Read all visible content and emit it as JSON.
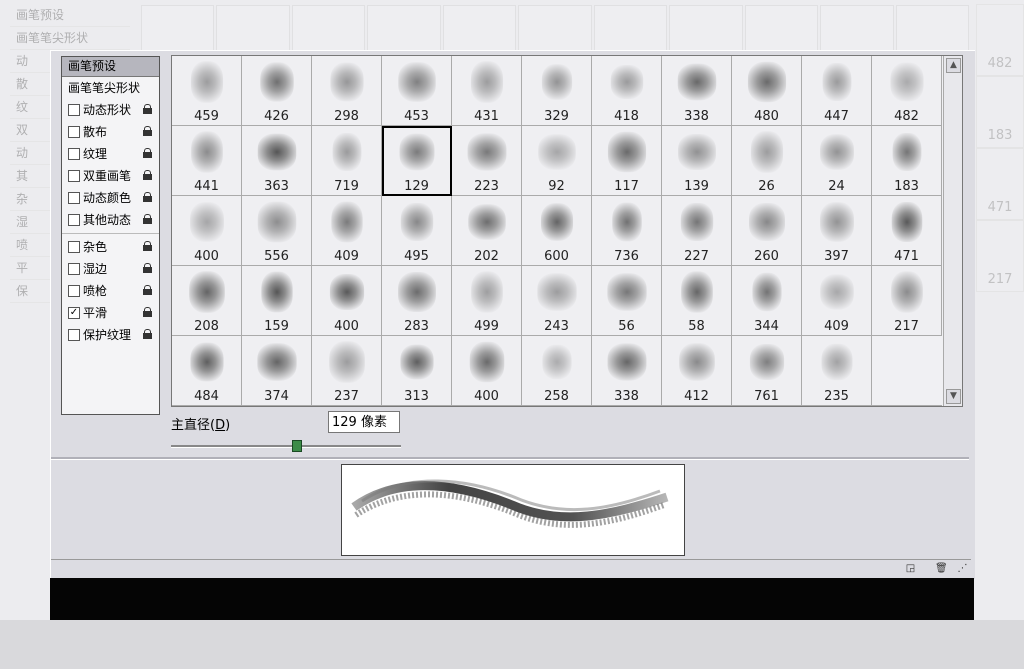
{
  "panel": {
    "preset_tab": "画笔预设",
    "tip_shape": "画笔笔尖形状",
    "options": [
      {
        "label": "动态形状",
        "checked": false
      },
      {
        "label": "散布",
        "checked": false
      },
      {
        "label": "纹理",
        "checked": false
      },
      {
        "label": "双重画笔",
        "checked": false
      },
      {
        "label": "动态颜色",
        "checked": false
      },
      {
        "label": "其他动态",
        "checked": false
      },
      {
        "label": "杂色",
        "checked": false
      },
      {
        "label": "湿边",
        "checked": false
      },
      {
        "label": "喷枪",
        "checked": false
      },
      {
        "label": "平滑",
        "checked": true
      },
      {
        "label": "保护纹理",
        "checked": false
      }
    ]
  },
  "brushes": [
    "459",
    "426",
    "298",
    "453",
    "431",
    "329",
    "418",
    "338",
    "480",
    "447",
    "482",
    "441",
    "363",
    "719",
    "129",
    "223",
    "92",
    "117",
    "139",
    "26",
    "24",
    "183",
    "400",
    "556",
    "409",
    "495",
    "202",
    "600",
    "736",
    "227",
    "260",
    "397",
    "471",
    "208",
    "159",
    "400",
    "283",
    "499",
    "243",
    "56",
    "58",
    "344",
    "409",
    "217",
    "484",
    "374",
    "237",
    "313",
    "400",
    "258",
    "338",
    "412",
    "761",
    "235"
  ],
  "selected_index": 14,
  "diameter": {
    "label": "主直径",
    "shortcut": "D",
    "value": "129 像素",
    "slider_fraction": 0.55
  },
  "background": {
    "left_rows": [
      "画笔预设",
      "画笔笔尖形状",
      "动",
      "散",
      "纹",
      "双",
      "动",
      "其",
      "杂",
      "湿",
      "喷",
      "平",
      "保"
    ],
    "right_numbers": [
      "482",
      "183",
      "471",
      "217"
    ]
  }
}
